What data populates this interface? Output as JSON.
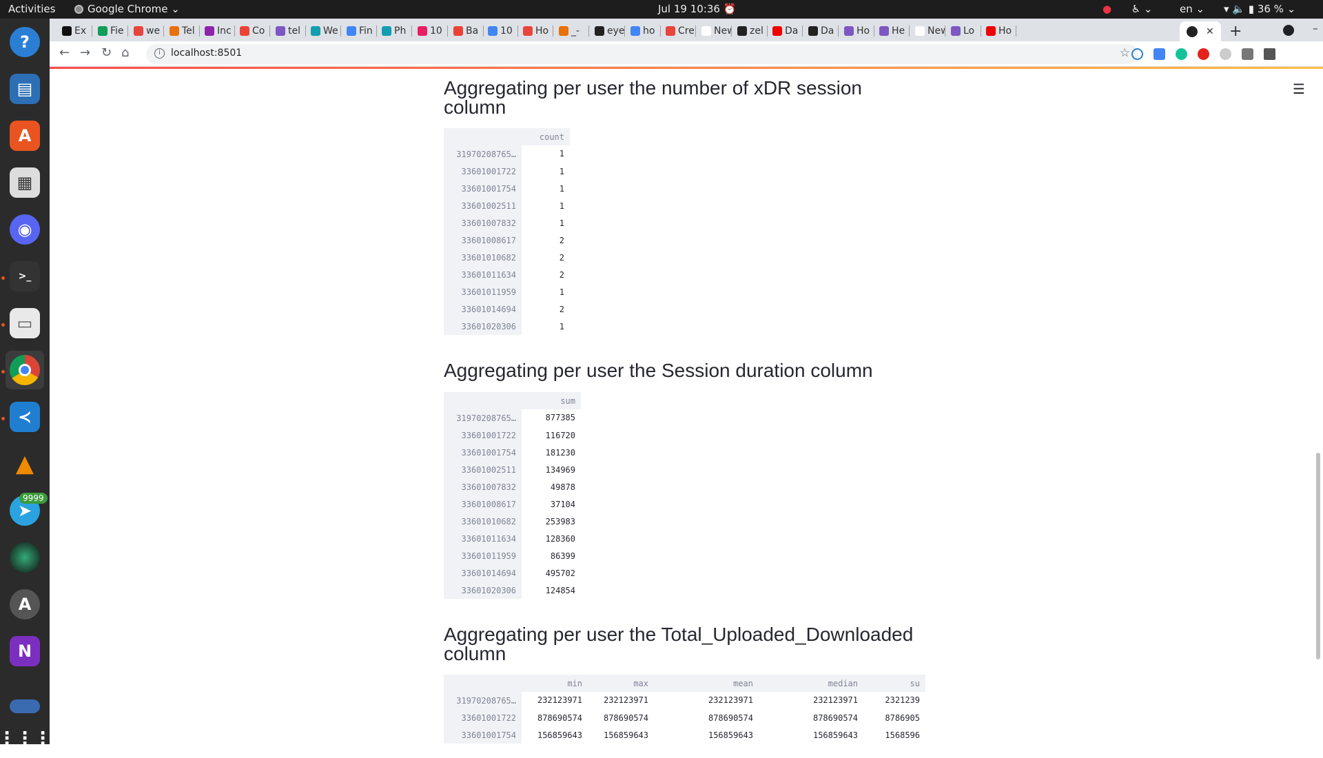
{
  "system_bar": {
    "activities": "Activities",
    "app_name": "Google Chrome",
    "clock": "Jul 19  10:36",
    "lang": "en",
    "battery": "36 %"
  },
  "dock": {
    "items": [
      "help-icon",
      "writer-icon",
      "app-center-icon",
      "document-viewer-icon",
      "discord-icon",
      "terminal-icon",
      "files-icon",
      "chrome-icon",
      "vscode-icon",
      "vlc-icon",
      "telegram-icon",
      "webcam-icon",
      "software-icon",
      "onenote-icon",
      "show-apps-icon"
    ],
    "telegram_badge": "9999"
  },
  "browser": {
    "tabs": [
      "Ex",
      "Fie",
      "we",
      "Tel",
      "Inc",
      "Co",
      "tel",
      "We",
      "Fin",
      "Ph",
      "10",
      "Ba",
      "10",
      "Ho",
      "_-",
      "eye",
      "ho",
      "Cre",
      "New T",
      "zel",
      "Da",
      "Da",
      "Ho",
      "He",
      "New T",
      "Lo",
      "Ho"
    ],
    "url": "localhost:8501"
  },
  "sections": [
    {
      "title_line1": "Aggregating per user the number of xDR session",
      "title_line2": "column",
      "columns": [
        "count"
      ],
      "rows": [
        {
          "index": "31970208765…",
          "values": [
            "1"
          ]
        },
        {
          "index": "33601001722",
          "values": [
            "1"
          ]
        },
        {
          "index": "33601001754",
          "values": [
            "1"
          ]
        },
        {
          "index": "33601002511",
          "values": [
            "1"
          ]
        },
        {
          "index": "33601007832",
          "values": [
            "1"
          ]
        },
        {
          "index": "33601008617",
          "values": [
            "2"
          ]
        },
        {
          "index": "33601010682",
          "values": [
            "2"
          ]
        },
        {
          "index": "33601011634",
          "values": [
            "2"
          ]
        },
        {
          "index": "33601011959",
          "values": [
            "1"
          ]
        },
        {
          "index": "33601014694",
          "values": [
            "2"
          ]
        },
        {
          "index": "33601020306",
          "values": [
            "1"
          ]
        }
      ]
    },
    {
      "title_line1": "Aggregating per user the Session duration column",
      "title_line2": "",
      "columns": [
        "sum"
      ],
      "rows": [
        {
          "index": "31970208765…",
          "values": [
            "877385"
          ]
        },
        {
          "index": "33601001722",
          "values": [
            "116720"
          ]
        },
        {
          "index": "33601001754",
          "values": [
            "181230"
          ]
        },
        {
          "index": "33601002511",
          "values": [
            "134969"
          ]
        },
        {
          "index": "33601007832",
          "values": [
            "49878"
          ]
        },
        {
          "index": "33601008617",
          "values": [
            "37104"
          ]
        },
        {
          "index": "33601010682",
          "values": [
            "253983"
          ]
        },
        {
          "index": "33601011634",
          "values": [
            "128360"
          ]
        },
        {
          "index": "33601011959",
          "values": [
            "86399"
          ]
        },
        {
          "index": "33601014694",
          "values": [
            "495702"
          ]
        },
        {
          "index": "33601020306",
          "values": [
            "124854"
          ]
        }
      ]
    },
    {
      "title_line1": "Aggregating per user the Total_Uploaded_Downloaded",
      "title_line2": "column",
      "columns": [
        "min",
        "max",
        "mean",
        "median",
        "su"
      ],
      "rows": [
        {
          "index": "31970208765…",
          "values": [
            "232123971",
            "232123971",
            "232123971",
            "232123971",
            "2321239"
          ]
        },
        {
          "index": "33601001722",
          "values": [
            "878690574",
            "878690574",
            "878690574",
            "878690574",
            "8786905"
          ]
        },
        {
          "index": "33601001754",
          "values": [
            "156859643",
            "156859643",
            "156859643",
            "156859643",
            "1568596"
          ]
        }
      ]
    }
  ]
}
